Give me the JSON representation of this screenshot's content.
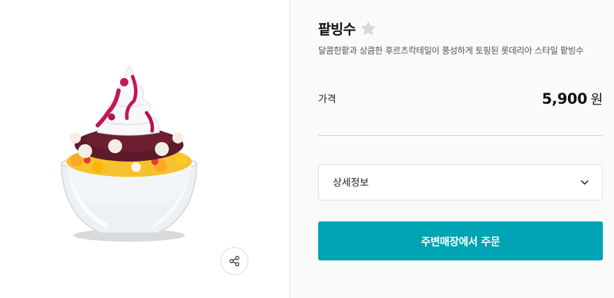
{
  "product": {
    "title": "팥빙수",
    "description": "달콤한팥과 상큼한 후르츠칵테일이 풍성하게 토핑된 롯데리아 스타일 팥빙수",
    "price_label": "가격",
    "price_amount": "5,900",
    "price_unit": "원",
    "image_icon": "patbingsu-photo",
    "favorite_icon": "star-icon"
  },
  "detail": {
    "label": "상세정보",
    "icon": "chevron-down-icon"
  },
  "order": {
    "label": "주변매장에서 주문"
  },
  "share": {
    "icon": "share-icon"
  },
  "colors": {
    "accent": "#00a3b4",
    "star": "#d8d8d8",
    "panel_bg": "#fafafa"
  }
}
